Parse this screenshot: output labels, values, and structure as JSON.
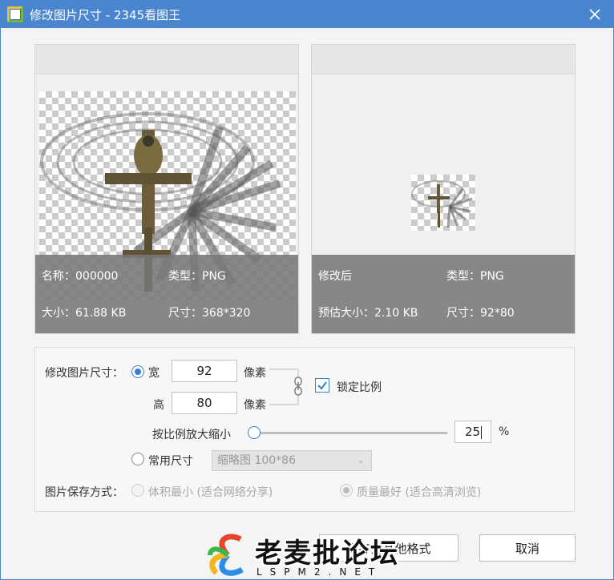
{
  "window": {
    "title": "修改图片尺寸 - 2345看图王"
  },
  "original": {
    "name_label": "名称：000000",
    "type_label": "类型：PNG",
    "size_label": "大小：61.88 KB",
    "dim_label": "尺寸：368*320"
  },
  "modified": {
    "name_label": "修改后",
    "type_label": "类型：PNG",
    "size_label": "预估大小：2.10 KB",
    "dim_label": "尺寸：92*80"
  },
  "settings": {
    "resize_label": "修改图片尺寸：",
    "width_label": "宽",
    "width_value": "92",
    "height_label": "高",
    "height_value": "80",
    "unit_label": "像素",
    "lock_label": "锁定比例",
    "scale_label": "按比例放大缩小",
    "scale_value": "25",
    "scale_fraction": 0.0,
    "percent_label": "%",
    "common_label": "常用尺寸",
    "common_option": "缩略图 100*86",
    "save_mode_label": "图片保存方式：",
    "option_small": "体积最小 (适合网络分享)",
    "option_quality": "质量最好 (适合高清浏览)"
  },
  "buttons": {
    "other_format": "另存为其他格式",
    "cancel": "取消"
  },
  "watermark": {
    "text": "老麦批论坛",
    "url": "LSPM2.NET"
  },
  "colors": {
    "titlebar": "#4a86d0",
    "accent": "#3a7dd0"
  }
}
